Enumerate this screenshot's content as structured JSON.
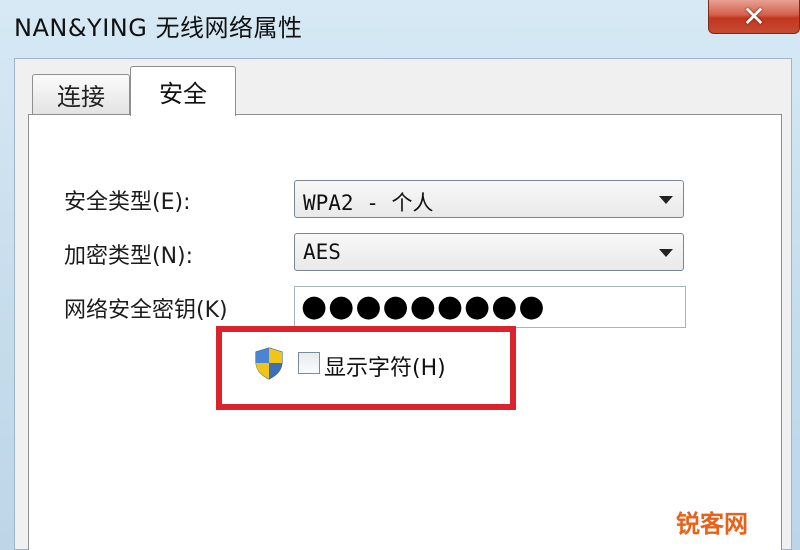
{
  "window": {
    "title": "NAN&YING 无线网络属性",
    "close_symbol": "✕"
  },
  "tabs": [
    {
      "label": "连接",
      "selected": false
    },
    {
      "label": "安全",
      "selected": true
    }
  ],
  "security": {
    "security_type_label": "安全类型(E):",
    "security_type_value": "WPA2 - 个人",
    "encryption_type_label": "加密类型(N):",
    "encryption_type_value": "AES",
    "network_key_label": "网络安全密钥(K)",
    "network_key_value": "●●●●●●●●●",
    "show_chars_label": "显示字符(H)",
    "show_chars_checked": false
  },
  "icons": {
    "shield": "uac-shield-icon",
    "dropdown": "chevron-down-icon"
  },
  "colors": {
    "highlight_border": "#d9232d",
    "watermark": "#e8611b"
  },
  "watermark": "锐客网"
}
